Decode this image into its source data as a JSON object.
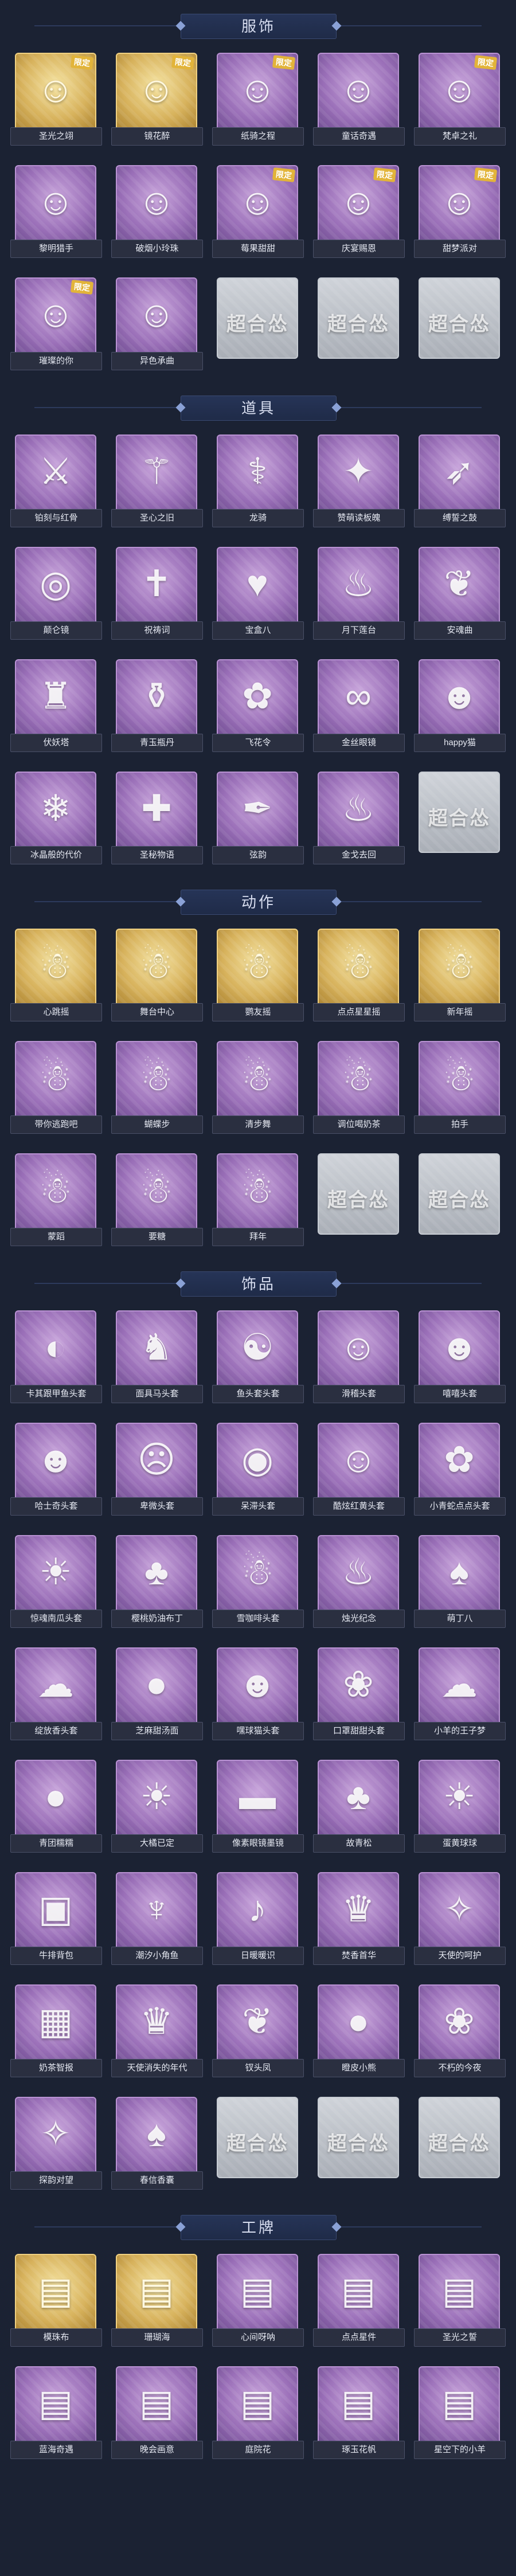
{
  "empty_watermark": "超合怂",
  "colors": {
    "background": "#1b2233",
    "rare_gold": "#d7b25c",
    "common_purple": "#9a6fb8",
    "empty_gray": "#a9aeb6"
  },
  "sections": [
    {
      "title": "服饰",
      "items": [
        {
          "label": "圣光之翊",
          "rarity": "gold",
          "icon": "portrait-icon",
          "badge": "限定"
        },
        {
          "label": "镜花醉",
          "rarity": "gold",
          "icon": "portrait-icon",
          "badge": "限定"
        },
        {
          "label": "纸骑之程",
          "rarity": "purple",
          "icon": "portrait-icon",
          "badge": "限定"
        },
        {
          "label": "童话奇遇",
          "rarity": "purple",
          "icon": "portrait-icon",
          "badge": ""
        },
        {
          "label": "梵卓之礼",
          "rarity": "purple",
          "icon": "portrait-icon",
          "badge": "限定"
        },
        {
          "label": "黎明猎手",
          "rarity": "purple",
          "icon": "portrait-icon",
          "badge": ""
        },
        {
          "label": "破烟小玲珠",
          "rarity": "purple",
          "icon": "portrait-icon",
          "badge": ""
        },
        {
          "label": "莓果甜甜",
          "rarity": "purple",
          "icon": "portrait-icon",
          "badge": "限定"
        },
        {
          "label": "庆宴赐恩",
          "rarity": "purple",
          "icon": "portrait-icon",
          "badge": "限定"
        },
        {
          "label": "甜梦派对",
          "rarity": "purple",
          "icon": "portrait-icon",
          "badge": "限定"
        },
        {
          "label": "璀璨的你",
          "rarity": "purple",
          "icon": "portrait-icon",
          "badge": "限定"
        },
        {
          "label": "异色承曲",
          "rarity": "purple",
          "icon": "portrait-icon",
          "badge": ""
        },
        {
          "label": "",
          "rarity": "empty",
          "icon": "",
          "badge": ""
        },
        {
          "label": "",
          "rarity": "empty",
          "icon": "",
          "badge": ""
        },
        {
          "label": "",
          "rarity": "empty",
          "icon": "",
          "badge": ""
        }
      ]
    },
    {
      "title": "道具",
      "items": [
        {
          "label": "铂刻与红骨",
          "rarity": "purple",
          "icon": "sword-icon",
          "badge": ""
        },
        {
          "label": "圣心之旧",
          "rarity": "purple",
          "icon": "scepter-icon",
          "badge": ""
        },
        {
          "label": "龙骑",
          "rarity": "purple",
          "icon": "staff-icon",
          "badge": ""
        },
        {
          "label": "赞萌读板魄",
          "rarity": "purple",
          "icon": "wand-icon",
          "badge": ""
        },
        {
          "label": "缚誓之鼓",
          "rarity": "purple",
          "icon": "bow-icon",
          "badge": ""
        },
        {
          "label": "颠仑镜",
          "rarity": "purple",
          "icon": "mirror-icon",
          "badge": ""
        },
        {
          "label": "祝祷词",
          "rarity": "purple",
          "icon": "cross-icon",
          "badge": ""
        },
        {
          "label": "宝盒八",
          "rarity": "purple",
          "icon": "heart-icon",
          "badge": ""
        },
        {
          "label": "月下莲台",
          "rarity": "purple",
          "icon": "lantern-icon",
          "badge": ""
        },
        {
          "label": "安魂曲",
          "rarity": "purple",
          "icon": "fan-icon",
          "badge": ""
        },
        {
          "label": "伏妖塔",
          "rarity": "purple",
          "icon": "tower-icon",
          "badge": ""
        },
        {
          "label": "青玉瓶丹",
          "rarity": "purple",
          "icon": "vase-icon",
          "badge": ""
        },
        {
          "label": "飞花令",
          "rarity": "purple",
          "icon": "flower-icon",
          "badge": ""
        },
        {
          "label": "金丝眼镜",
          "rarity": "purple",
          "icon": "glasses-icon",
          "badge": ""
        },
        {
          "label": "happy猫",
          "rarity": "purple",
          "icon": "cat-icon",
          "badge": ""
        },
        {
          "label": "冰晶般的代价",
          "rarity": "purple",
          "icon": "crystal-icon",
          "badge": ""
        },
        {
          "label": "圣秘物语",
          "rarity": "purple",
          "icon": "medkit-icon",
          "badge": ""
        },
        {
          "label": "弦韵",
          "rarity": "purple",
          "icon": "quill-icon",
          "badge": ""
        },
        {
          "label": "金戈去回",
          "rarity": "purple",
          "icon": "lantern-icon",
          "badge": ""
        },
        {
          "label": "",
          "rarity": "empty",
          "icon": "",
          "badge": ""
        }
      ]
    },
    {
      "title": "动作",
      "items": [
        {
          "label": "心跳摇",
          "rarity": "gold",
          "icon": "pose-icon",
          "badge": ""
        },
        {
          "label": "舞台中心",
          "rarity": "gold",
          "icon": "pose-icon",
          "badge": ""
        },
        {
          "label": "鹦友摇",
          "rarity": "gold",
          "icon": "pose-icon",
          "badge": ""
        },
        {
          "label": "点点星星摇",
          "rarity": "gold",
          "icon": "pose-icon",
          "badge": ""
        },
        {
          "label": "新年摇",
          "rarity": "gold",
          "icon": "pose-icon",
          "badge": ""
        },
        {
          "label": "带你逃跑吧",
          "rarity": "purple",
          "icon": "pose-icon",
          "badge": ""
        },
        {
          "label": "蝴蝶步",
          "rarity": "purple",
          "icon": "pose-icon",
          "badge": ""
        },
        {
          "label": "清步舞",
          "rarity": "purple",
          "icon": "pose-icon",
          "badge": ""
        },
        {
          "label": "调位喝奶茶",
          "rarity": "purple",
          "icon": "pose-icon",
          "badge": ""
        },
        {
          "label": "拍手",
          "rarity": "purple",
          "icon": "pose-icon",
          "badge": ""
        },
        {
          "label": "蒙蹈",
          "rarity": "purple",
          "icon": "pose-icon",
          "badge": ""
        },
        {
          "label": "要糖",
          "rarity": "purple",
          "icon": "pose-icon",
          "badge": ""
        },
        {
          "label": "拜年",
          "rarity": "purple",
          "icon": "pose-icon",
          "badge": ""
        },
        {
          "label": "",
          "rarity": "empty",
          "icon": "",
          "badge": ""
        },
        {
          "label": "",
          "rarity": "empty",
          "icon": "",
          "badge": ""
        }
      ]
    },
    {
      "title": "饰品",
      "items": [
        {
          "label": "卡其跟甲鱼头套",
          "rarity": "purple",
          "icon": "mask-icon",
          "badge": ""
        },
        {
          "label": "面具马头套",
          "rarity": "purple",
          "icon": "horse-icon",
          "badge": ""
        },
        {
          "label": "鱼头套头套",
          "rarity": "purple",
          "icon": "fish-icon",
          "badge": ""
        },
        {
          "label": "滑稽头套",
          "rarity": "purple",
          "icon": "smile-icon",
          "badge": ""
        },
        {
          "label": "嘻嘻头套",
          "rarity": "purple",
          "icon": "grin-icon",
          "badge": ""
        },
        {
          "label": "哈士奇头套",
          "rarity": "purple",
          "icon": "dog-icon",
          "badge": ""
        },
        {
          "label": "卑微头套",
          "rarity": "purple",
          "icon": "sad-icon",
          "badge": ""
        },
        {
          "label": "呆滞头套",
          "rarity": "purple",
          "icon": "dazed-icon",
          "badge": ""
        },
        {
          "label": "酷炫红黄头套",
          "rarity": "purple",
          "icon": "cool-icon",
          "badge": ""
        },
        {
          "label": "小青蛇点点头套",
          "rarity": "purple",
          "icon": "snake-icon",
          "badge": ""
        },
        {
          "label": "惊魂南瓜头套",
          "rarity": "purple",
          "icon": "pumpkin-icon",
          "badge": ""
        },
        {
          "label": "樱桃奶油布丁",
          "rarity": "purple",
          "icon": "pudding-icon",
          "badge": ""
        },
        {
          "label": "雪咖啡头套",
          "rarity": "purple",
          "icon": "penguin-icon",
          "badge": ""
        },
        {
          "label": "烛光纪念",
          "rarity": "purple",
          "icon": "candle-icon",
          "badge": ""
        },
        {
          "label": "萌丁八",
          "rarity": "purple",
          "icon": "garlic-icon",
          "badge": ""
        },
        {
          "label": "绽放香头套",
          "rarity": "purple",
          "icon": "cloud-icon",
          "badge": ""
        },
        {
          "label": "芝麻甜汤面",
          "rarity": "purple",
          "icon": "bun-icon",
          "badge": ""
        },
        {
          "label": "嘿球猫头套",
          "rarity": "purple",
          "icon": "cat-icon",
          "badge": ""
        },
        {
          "label": "口罩甜甜头套",
          "rarity": "purple",
          "icon": "bunny-icon",
          "badge": ""
        },
        {
          "label": "小羊的王子梦",
          "rarity": "purple",
          "icon": "sheep-icon",
          "badge": ""
        },
        {
          "label": "青团糯糯",
          "rarity": "purple",
          "icon": "dumpling-icon",
          "badge": ""
        },
        {
          "label": "大橘已定",
          "rarity": "purple",
          "icon": "orange-icon",
          "badge": ""
        },
        {
          "label": "像素眼镜墨镜",
          "rarity": "purple",
          "icon": "sunglasses-icon",
          "badge": ""
        },
        {
          "label": "故青松",
          "rarity": "purple",
          "icon": "bonsai-icon",
          "badge": ""
        },
        {
          "label": "蛋黄球球",
          "rarity": "purple",
          "icon": "chick-icon",
          "badge": ""
        },
        {
          "label": "牛排背包",
          "rarity": "purple",
          "icon": "backpack-icon",
          "badge": ""
        },
        {
          "label": "潮汐小角鱼",
          "rarity": "purple",
          "icon": "squid-icon",
          "badge": ""
        },
        {
          "label": "日暖暖识",
          "rarity": "purple",
          "icon": "note-icon",
          "badge": ""
        },
        {
          "label": "焚香首华",
          "rarity": "purple",
          "icon": "doll-icon",
          "badge": ""
        },
        {
          "label": "天使的呵护",
          "rarity": "purple",
          "icon": "angel-icon",
          "badge": ""
        },
        {
          "label": "奶茶智报",
          "rarity": "purple",
          "icon": "qr-icon",
          "badge": ""
        },
        {
          "label": "天使消失的年代",
          "rarity": "purple",
          "icon": "doll-icon",
          "badge": ""
        },
        {
          "label": "钗头凤",
          "rarity": "purple",
          "icon": "phoenix-icon",
          "badge": ""
        },
        {
          "label": "瞪皮小熊",
          "rarity": "purple",
          "icon": "bear-icon",
          "badge": ""
        },
        {
          "label": "不朽的今夜",
          "rarity": "purple",
          "icon": "rabbit-icon",
          "badge": ""
        },
        {
          "label": "探韵对望",
          "rarity": "purple",
          "icon": "pendant-icon",
          "badge": ""
        },
        {
          "label": "春信香囊",
          "rarity": "purple",
          "icon": "sachet-icon",
          "badge": ""
        },
        {
          "label": "",
          "rarity": "empty",
          "icon": "",
          "badge": ""
        },
        {
          "label": "",
          "rarity": "empty",
          "icon": "",
          "badge": ""
        },
        {
          "label": "",
          "rarity": "empty",
          "icon": "",
          "badge": ""
        }
      ]
    },
    {
      "title": "工牌",
      "items": [
        {
          "label": "模珠布",
          "rarity": "gold",
          "icon": "card-icon",
          "badge": ""
        },
        {
          "label": "珊瑚海",
          "rarity": "gold",
          "icon": "card-icon",
          "badge": ""
        },
        {
          "label": "心间呀呐",
          "rarity": "purple",
          "icon": "card-icon",
          "badge": ""
        },
        {
          "label": "点点星件",
          "rarity": "purple",
          "icon": "card-icon",
          "badge": ""
        },
        {
          "label": "圣光之誓",
          "rarity": "purple",
          "icon": "card-icon",
          "badge": ""
        },
        {
          "label": "蓝海奇遇",
          "rarity": "purple",
          "icon": "card-icon",
          "badge": ""
        },
        {
          "label": "晚会画意",
          "rarity": "purple",
          "icon": "card-icon",
          "badge": ""
        },
        {
          "label": "庭院花",
          "rarity": "purple",
          "icon": "card-icon",
          "badge": ""
        },
        {
          "label": "琢玉花帆",
          "rarity": "purple",
          "icon": "card-icon",
          "badge": ""
        },
        {
          "label": "星空下的小羊",
          "rarity": "purple",
          "icon": "card-icon",
          "badge": ""
        }
      ]
    }
  ]
}
